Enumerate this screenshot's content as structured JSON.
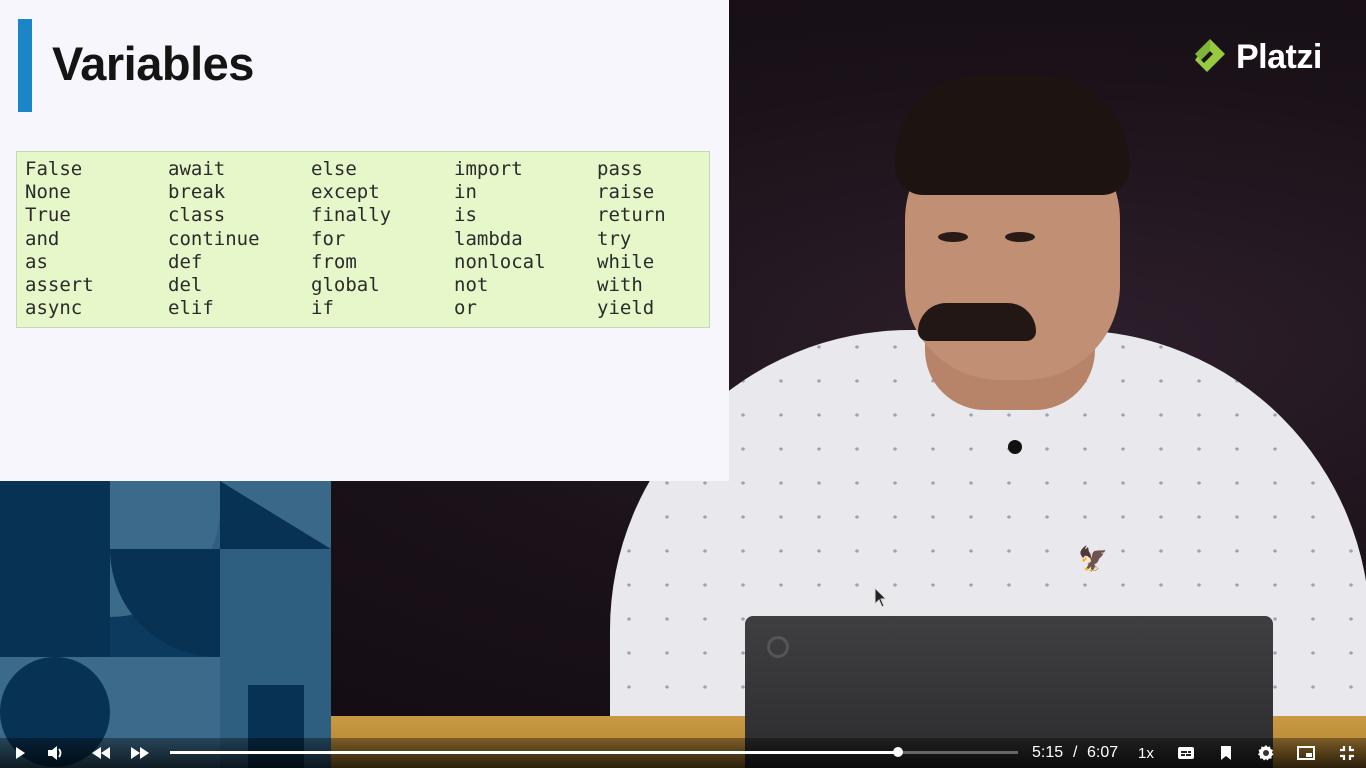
{
  "slide": {
    "title": "Variables",
    "keyword_columns": [
      [
        "False",
        "None",
        "True",
        "and",
        "as",
        "assert",
        "async"
      ],
      [
        "await",
        "break",
        "class",
        "continue",
        "def",
        "del",
        "elif"
      ],
      [
        "else",
        "except",
        "finally",
        "for",
        "from",
        "global",
        "if"
      ],
      [
        "import",
        "in",
        "is",
        "lambda",
        "nonlocal",
        "not",
        "or"
      ],
      [
        "pass",
        "raise",
        "return",
        "try",
        "while",
        "with",
        "yield"
      ]
    ]
  },
  "brand": {
    "name": "Platzi",
    "color": "#98ca3f"
  },
  "player": {
    "current_time": "5:15",
    "separator": "/",
    "duration": "6:07",
    "speed": "1x",
    "progress": 0.858,
    "icons": [
      "play-icon",
      "volume-icon",
      "rewind-icon",
      "fast-forward-icon",
      "captions-icon",
      "bookmark-icon",
      "gear-icon",
      "picture-in-picture-icon",
      "exit-fullscreen-icon"
    ]
  },
  "colors": {
    "accent_bar": "#1a86c8",
    "keyword_box": "#e6f7c9",
    "pattern_blue": "#0b3a5e"
  }
}
